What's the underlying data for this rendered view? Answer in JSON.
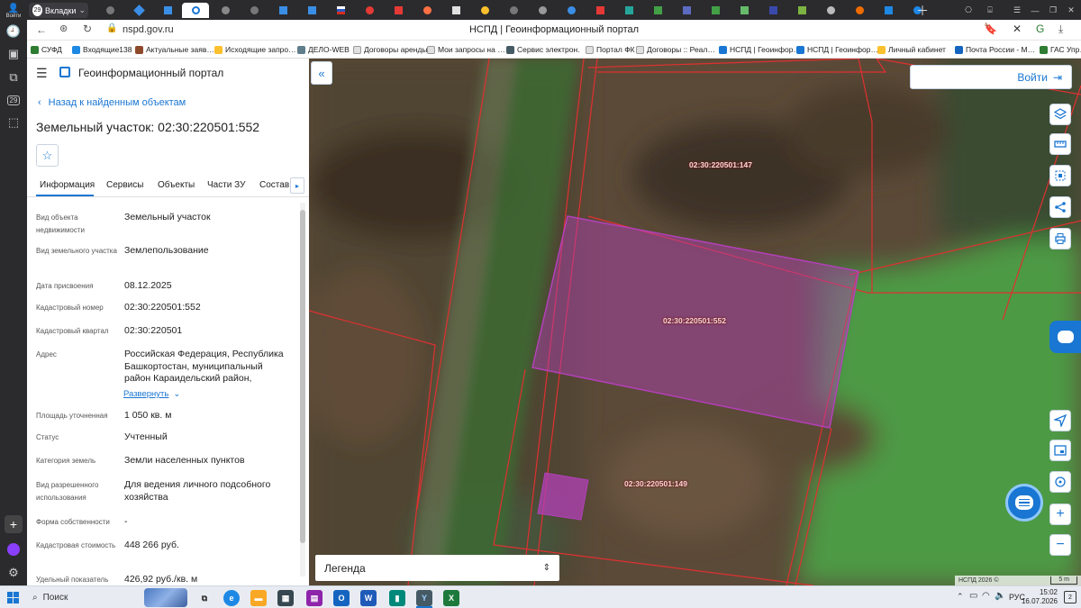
{
  "browser": {
    "tabs_count_label": "29",
    "tabs_label": "Вкладки",
    "yandex_login": "Войти",
    "sidebar_badge": "29",
    "url": "nspd.gov.ru",
    "page_title": "НСПД | Геоинформационный портал"
  },
  "bookmarks": [
    "СУФД",
    "Входящие138",
    "Актуальные заяв…",
    "Исходящие запро…",
    "ДЕЛО-WEB",
    "Договоры аренды…",
    "Мои запросы на …",
    "Сервис электрон…",
    "Портал ФК",
    "Договоры :: Реал…",
    "НСПД | Геоинфор…",
    "НСПД | Геоинфор…",
    "Личный кабинет",
    "Почта России - М…",
    "ГАС Упр…"
  ],
  "portal": {
    "title": "Геоинформационный портал",
    "back_link": "Назад к найденным объектам",
    "object_title": "Земельный участок: 02:30:220501:552",
    "tabs": [
      "Информация",
      "Сервисы",
      "Объекты",
      "Части ЗУ",
      "Состав"
    ]
  },
  "attributes": [
    {
      "label": "Вид объекта недвижимости",
      "value": "Земельный участок"
    },
    {
      "label": "Вид земельного участка",
      "value": "Землепользование"
    },
    {
      "label": "Дата присвоения",
      "value": "08.12.2025"
    },
    {
      "label": "Кадастровый номер",
      "value": "02:30:220501:552"
    },
    {
      "label": "Кадастровый квартал",
      "value": "02:30:220501"
    },
    {
      "label": "Адрес",
      "value": "Российская Федерация, Республика Башкортостан, муниципальный район Караидельский район,"
    },
    {
      "label": "Площадь уточненная",
      "value": "1 050 кв. м"
    },
    {
      "label": "Статус",
      "value": "Учтенный"
    },
    {
      "label": "Категория земель",
      "value": "Земли населенных пунктов"
    },
    {
      "label": "Вид разрешенного использования",
      "value": "Для ведения личного подсобного хозяйства"
    },
    {
      "label": "Форма собственности",
      "value": "-"
    },
    {
      "label": "Кадастровая стоимость",
      "value": "448 266 руб."
    },
    {
      "label": "Удельный показатель",
      "value": "426,92 руб./кв. м"
    }
  ],
  "address_expand": "Развернуть",
  "map": {
    "login_button": "Войти",
    "parcels": [
      "02:30:220501:147",
      "02:30:220501:552",
      "02:30:220501:149"
    ],
    "legend": "Легенда",
    "copyright": "НСПД 2026 ©",
    "scale": "5 m"
  },
  "taskbar": {
    "search": "Поиск",
    "lang": "РУС",
    "time": "15:02",
    "date": "16.07.2026",
    "notif": "2"
  },
  "colors": {
    "accent": "#1976d2",
    "parcel_fill": "#b340b8",
    "parcel_border": "#e03030"
  }
}
